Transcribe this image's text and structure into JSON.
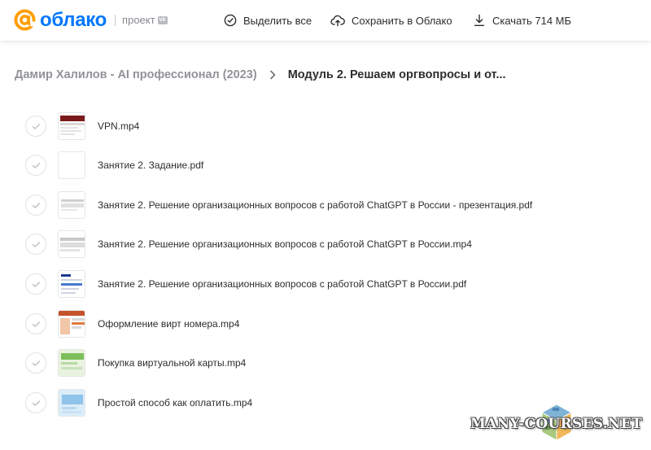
{
  "header": {
    "logo_text": "облако",
    "logo_project": "проект",
    "logo_badge": "vk",
    "actions": {
      "select_all": "Выделить все",
      "save_to_cloud": "Сохранить в Облако",
      "download": "Скачать 714 МБ"
    }
  },
  "breadcrumb": {
    "parent": "Дамир Халилов - AI профессионал (2023)",
    "current": "Модуль 2. Решаем оргвопросы и от..."
  },
  "files": [
    {
      "name": "VPN.mp4",
      "thumb": "video-dark-red"
    },
    {
      "name": "Занятие 2. Задание.pdf",
      "thumb": "blank-document"
    },
    {
      "name": "Занятие 2. Решение организационных вопросов с работой ChatGPT в России - презентация.pdf",
      "thumb": "presentation-gray"
    },
    {
      "name": "Занятие 2. Решение организационных вопросов с работой ChatGPT в России.mp4",
      "thumb": "video-gray"
    },
    {
      "name": "Занятие 2. Решение организационных вопросов с работой ChatGPT в России.pdf",
      "thumb": "document-blue"
    },
    {
      "name": "Оформление вирт номера.mp4",
      "thumb": "video-orange"
    },
    {
      "name": "Покупка виртуальной карты.mp4",
      "thumb": "video-green"
    },
    {
      "name": "Простой способ как оплатить.mp4",
      "thumb": "video-blue"
    }
  ],
  "watermark": {
    "text": "MANY-COURSES.NET"
  },
  "colors": {
    "brand_blue": "#0077ff",
    "brand_orange": "#ff9e00",
    "text_primary": "#2c2d2e",
    "text_secondary": "#919399"
  }
}
